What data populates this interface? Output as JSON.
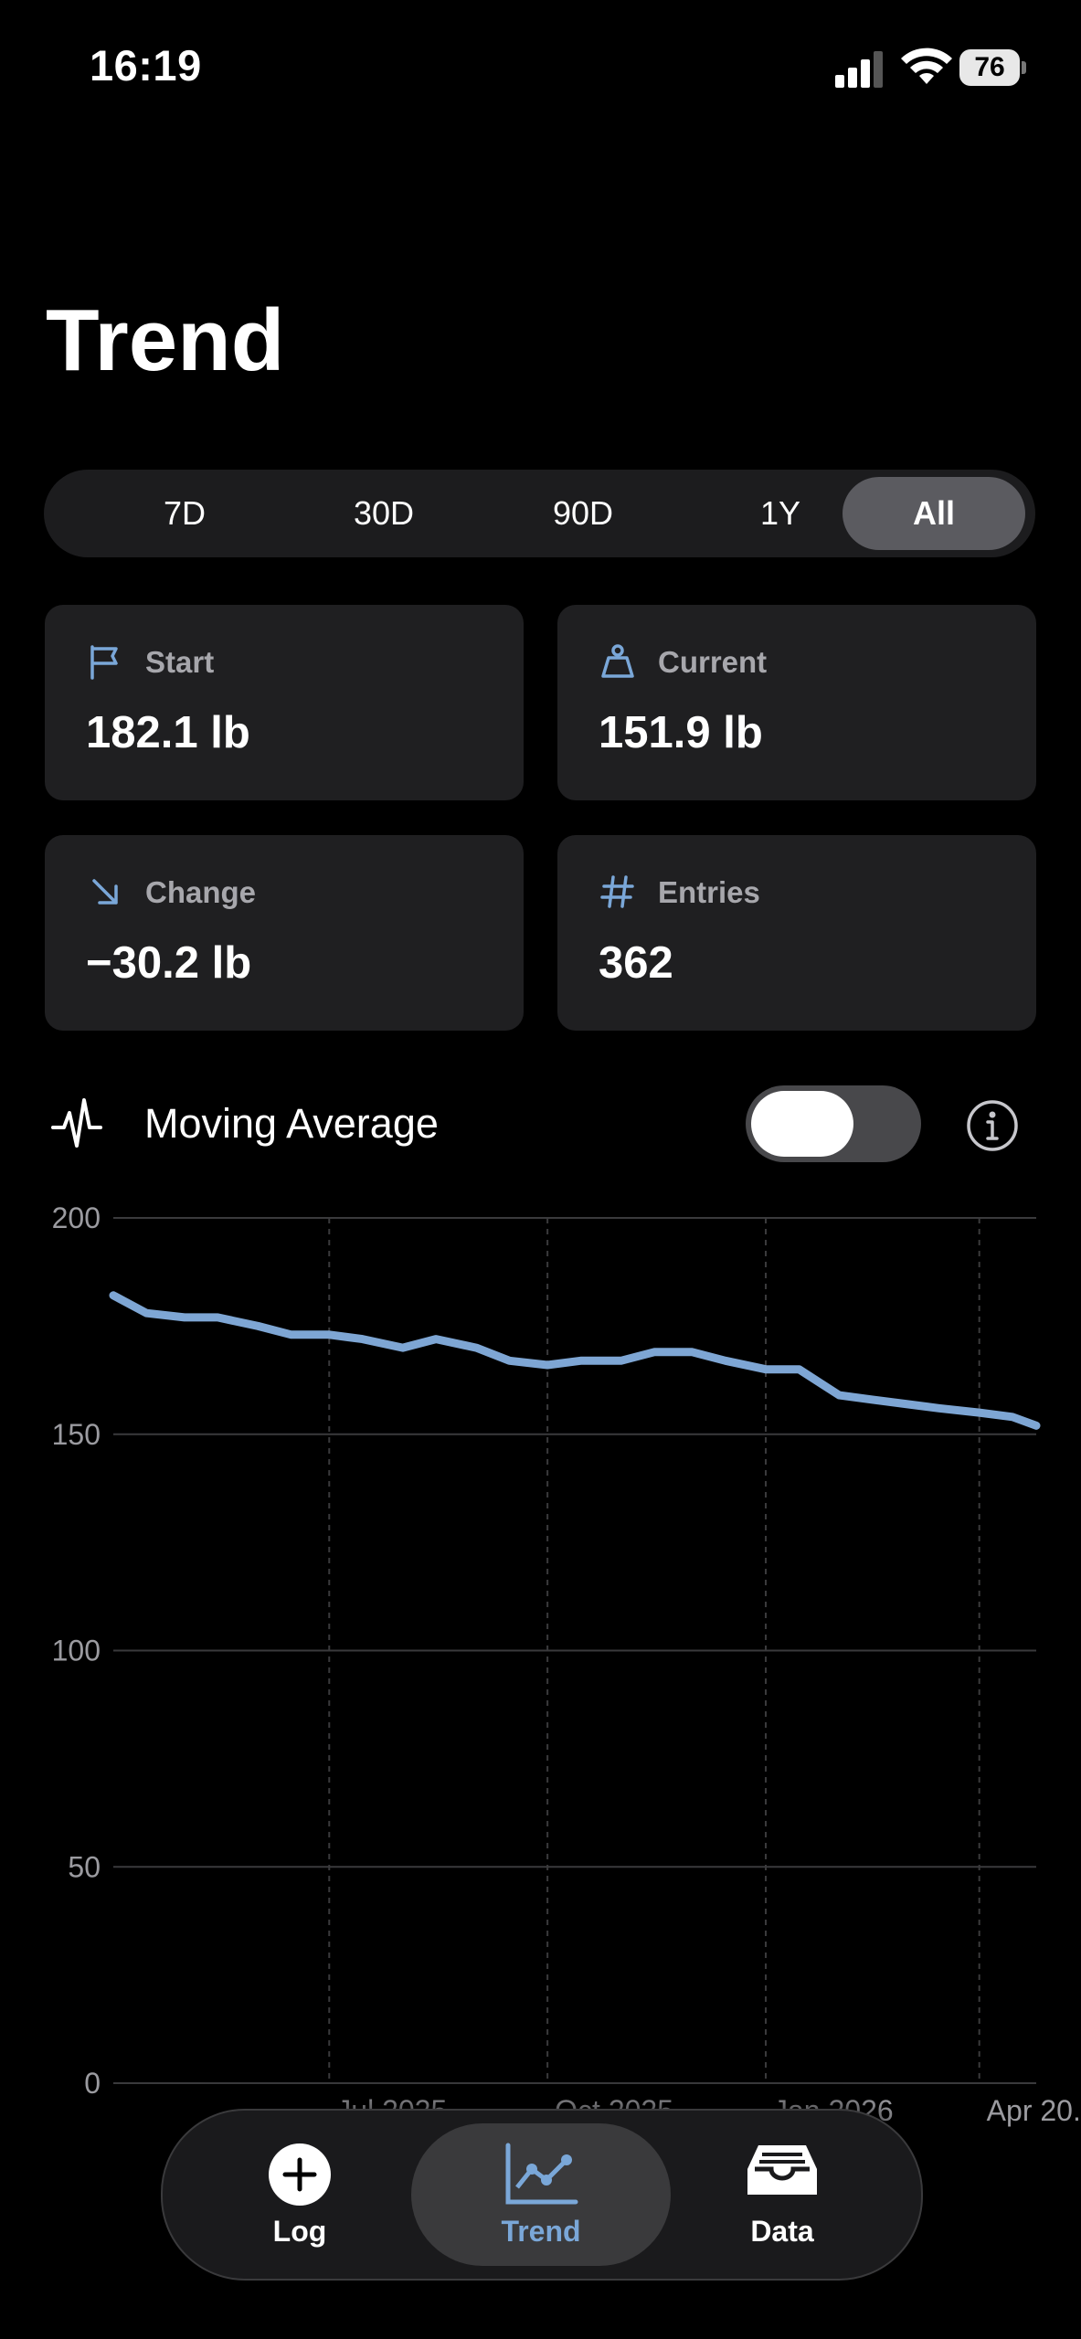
{
  "status_bar": {
    "time": "16:19",
    "battery": "76"
  },
  "page": {
    "title": "Trend"
  },
  "range_selector": {
    "options": [
      "7D",
      "30D",
      "90D",
      "1Y",
      "All"
    ],
    "selected": "All"
  },
  "stats": {
    "start": {
      "label": "Start",
      "value": "182.1 lb",
      "icon": "flag-icon"
    },
    "current": {
      "label": "Current",
      "value": "151.9 lb",
      "icon": "scale-weight-icon"
    },
    "change": {
      "label": "Change",
      "value": "−30.2 lb",
      "icon": "arrow-down-right-icon"
    },
    "entries": {
      "label": "Entries",
      "value": "362",
      "icon": "hash-icon"
    }
  },
  "moving_average": {
    "label": "Moving Average",
    "enabled": false
  },
  "colors": {
    "accent": "#7aa7d8",
    "line": "#7ea6d4",
    "card_bg": "#1f1f21"
  },
  "chart_data": {
    "type": "line",
    "title": "",
    "xlabel": "",
    "ylabel": "",
    "ylim": [
      0,
      200
    ],
    "yticks": [
      0,
      50,
      100,
      150,
      200
    ],
    "xtick_labels": [
      "Jul 2025",
      "Oct 2025",
      "Jan 2026",
      "Apr 20..."
    ],
    "xtick_positions": [
      "2025-07-01",
      "2025-10-01",
      "2026-01-01",
      "2026-04-01"
    ],
    "x_range": [
      "2025-04-01",
      "2026-04-25"
    ],
    "series": [
      {
        "x": [
          "2025-04-01",
          "2025-04-15",
          "2025-05-01",
          "2025-05-15",
          "2025-06-01",
          "2025-06-15",
          "2025-07-01",
          "2025-07-15",
          "2025-08-01",
          "2025-08-15",
          "2025-09-01",
          "2025-09-15",
          "2025-10-01",
          "2025-10-15",
          "2025-11-01",
          "2025-11-15",
          "2025-12-01",
          "2025-12-15",
          "2026-01-01",
          "2026-01-15",
          "2026-02-01",
          "2026-02-15",
          "2026-03-01",
          "2026-03-15",
          "2026-04-01",
          "2026-04-15",
          "2026-04-25"
        ],
        "values": [
          182.1,
          178,
          177,
          177,
          175,
          173,
          173,
          172,
          170,
          172,
          170,
          167,
          166,
          167,
          167,
          169,
          169,
          167,
          165,
          165,
          159,
          158,
          157,
          156,
          155,
          154,
          152
        ]
      }
    ],
    "grid": true
  },
  "tabs": [
    {
      "label": "Log",
      "icon": "plus-circle-icon",
      "active": false
    },
    {
      "label": "Trend",
      "icon": "chart-line-icon",
      "active": true
    },
    {
      "label": "Data",
      "icon": "tray-icon",
      "active": false
    }
  ]
}
